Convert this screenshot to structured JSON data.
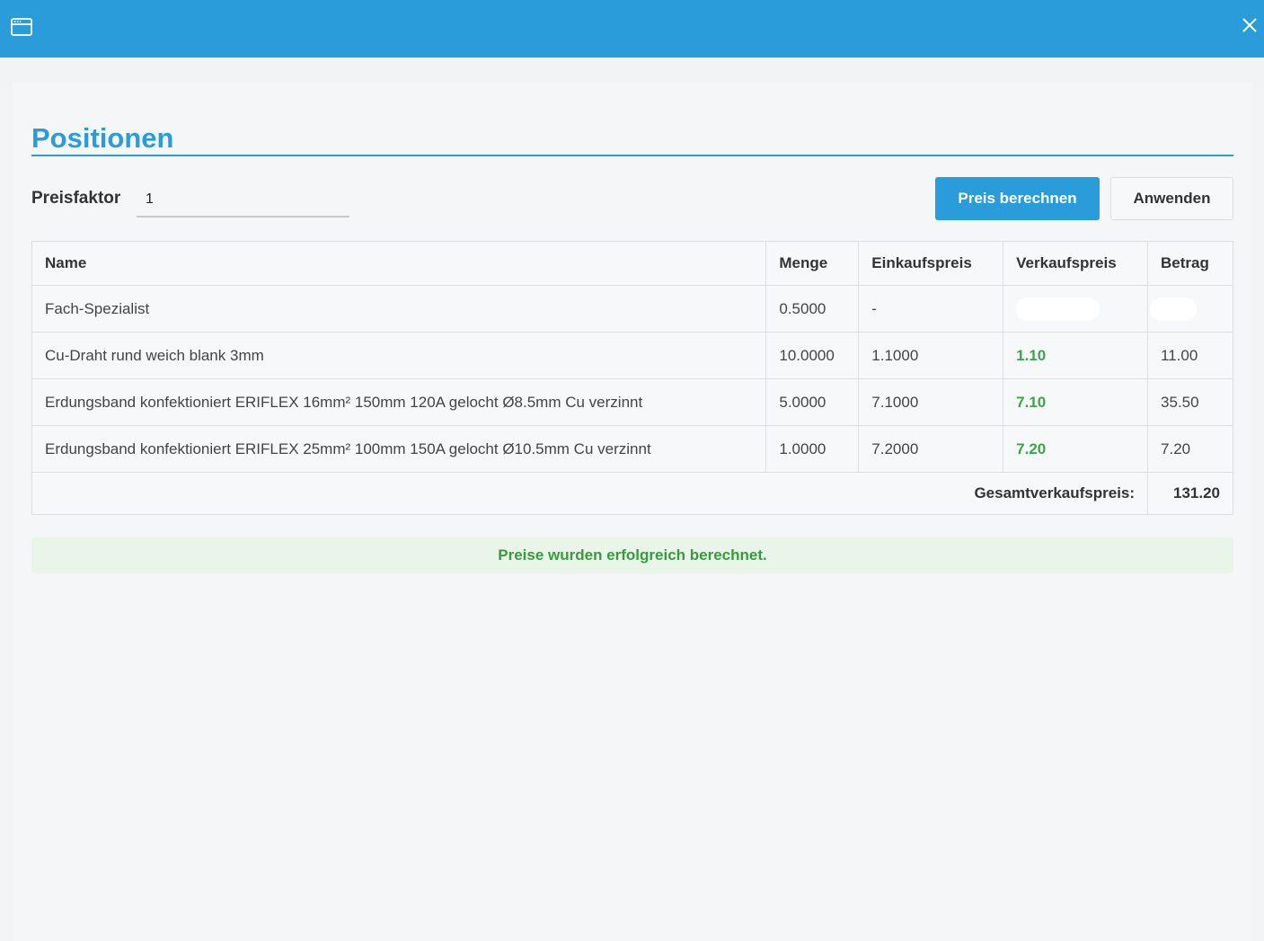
{
  "window": {
    "icon": "window-icon",
    "close_icon": "close-icon"
  },
  "page": {
    "title": "Positionen"
  },
  "toolbar": {
    "factor_label": "Preisfaktor",
    "factor_value": "1",
    "calculate_label": "Preis berechnen",
    "apply_label": "Anwenden"
  },
  "table": {
    "headers": [
      "Name",
      "Menge",
      "Einkaufspreis",
      "Verkaufspreis",
      "Betrag"
    ],
    "rows": [
      {
        "name": "Fach-Spezialist",
        "menge": "0.5000",
        "einkaufspreis": "-",
        "verkaufspreis": "",
        "betrag": ""
      },
      {
        "name": "Cu-Draht rund weich blank 3mm",
        "menge": "10.0000",
        "einkaufspreis": "1.1000",
        "verkaufspreis": "1.10",
        "betrag": "11.00"
      },
      {
        "name": "Erdungsband konfektioniert ERIFLEX 16mm² 150mm 120A gelocht Ø8.5mm Cu verzinnt",
        "menge": "5.0000",
        "einkaufspreis": "7.1000",
        "verkaufspreis": "7.10",
        "betrag": "35.50"
      },
      {
        "name": "Erdungsband konfektioniert ERIFLEX 25mm² 100mm 150A gelocht Ø10.5mm Cu verzinnt",
        "menge": "1.0000",
        "einkaufspreis": "7.2000",
        "verkaufspreis": "7.20",
        "betrag": "7.20"
      }
    ],
    "total_label": "Gesamtverkaufspreis:",
    "total_value": "131.20"
  },
  "status": {
    "message": "Preise wurden erfolgreich berechnet."
  },
  "colors": {
    "primary": "#2a9cd9",
    "success_text": "#3a9a3f",
    "success_bg": "#e8f5e8",
    "price_green": "#3aa64a"
  }
}
